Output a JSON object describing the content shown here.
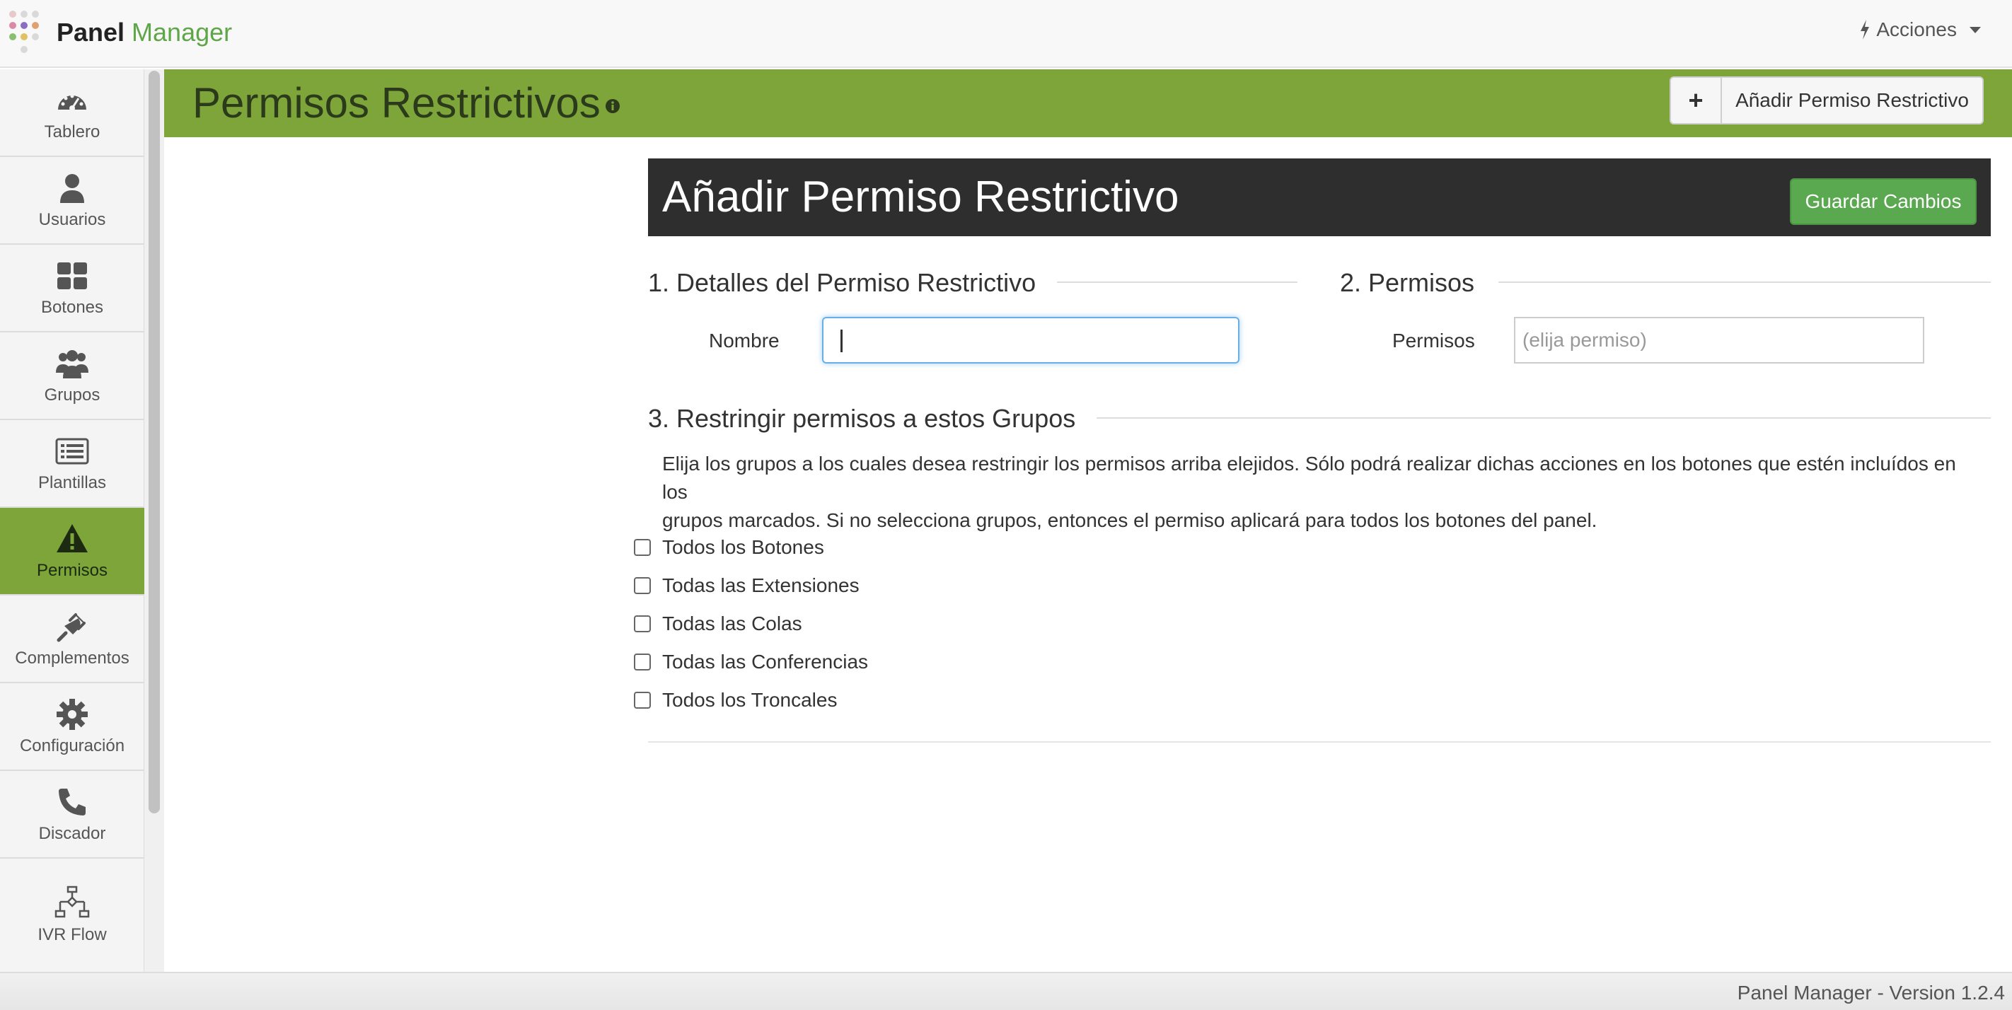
{
  "brand": {
    "name_bold": "Panel",
    "name_light": "Manager"
  },
  "topbar": {
    "actions_label": "Acciones"
  },
  "sidebar": {
    "items": [
      {
        "label": "Tablero",
        "icon": "dashboard-icon"
      },
      {
        "label": "Usuarios",
        "icon": "user-icon"
      },
      {
        "label": "Botones",
        "icon": "grid-icon"
      },
      {
        "label": "Grupos",
        "icon": "users-icon"
      },
      {
        "label": "Plantillas",
        "icon": "list-icon"
      },
      {
        "label": "Permisos",
        "icon": "warning-icon",
        "active": true
      },
      {
        "label": "Complementos",
        "icon": "plug-icon"
      },
      {
        "label": "Configuración",
        "icon": "gear-icon"
      },
      {
        "label": "Discador",
        "icon": "phone-icon"
      },
      {
        "label": "IVR Flow",
        "icon": "flow-icon"
      }
    ]
  },
  "header": {
    "title": "Permisos Restrictivos",
    "add_button_label": "Añadir Permiso Restrictivo"
  },
  "form": {
    "title": "Añadir Permiso Restrictivo",
    "save_label": "Guardar Cambios",
    "section1_title": "1. Detalles del Permiso Restrictivo",
    "name_label": "Nombre",
    "name_value": "",
    "section2_title": "2. Permisos",
    "perm_label": "Permisos",
    "perm_placeholder": "(elija permiso)",
    "section3_title": "3. Restringir permisos a estos Grupos",
    "description_line1": "Elija los grupos a los cuales desea restringir los permisos arriba elejidos. Sólo podrá realizar dichas acciones en los botones que estén incluídos en los",
    "description_line2": "grupos marcados. Si no selecciona grupos, entonces el permiso aplicará para todos los botones del panel.",
    "groups": [
      {
        "label": "Todos los Botones",
        "checked": false
      },
      {
        "label": "Todas las Extensiones",
        "checked": false
      },
      {
        "label": "Todas las Colas",
        "checked": false
      },
      {
        "label": "Todas las Conferencias",
        "checked": false
      },
      {
        "label": "Todos los Troncales",
        "checked": false
      }
    ]
  },
  "footer": {
    "version_text": "Panel Manager - Version 1.2.4"
  },
  "colors": {
    "accent": "#7ea53a",
    "brand_green": "#5fa648",
    "save_green": "#5aa84f",
    "dark_panel": "#2e2e2e"
  }
}
